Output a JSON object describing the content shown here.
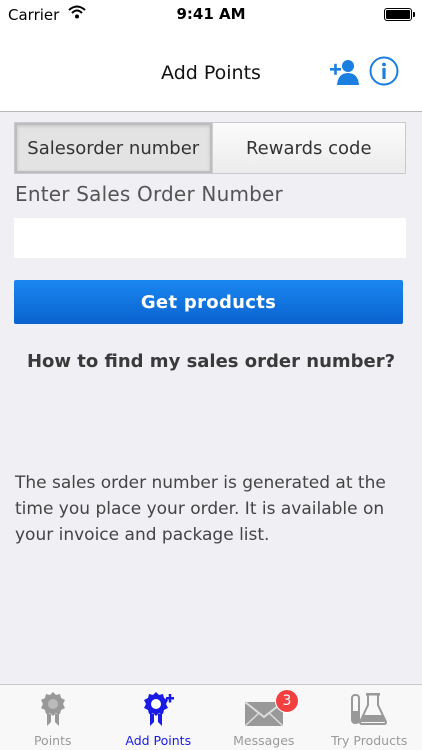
{
  "status_bar": {
    "carrier": "Carrier",
    "time": "9:41 AM"
  },
  "nav": {
    "title": "Add Points"
  },
  "segmented": {
    "options": [
      "Salesorder number",
      "Rewards code"
    ],
    "selected": "Salesorder number"
  },
  "form": {
    "field_label": "Enter Sales Order Number",
    "input_value": "",
    "input_placeholder": "",
    "submit_label": "Get products"
  },
  "help": {
    "heading": "How to find my sales order number?",
    "body": "The sales order number is generated at the time you place your order. It is available on your invoice and package list."
  },
  "tab_bar": {
    "items": [
      {
        "label": "Points",
        "icon": "award-badge-icon"
      },
      {
        "label": "Add Points",
        "icon": "add-badge-icon"
      },
      {
        "label": "Messages",
        "icon": "envelope-icon",
        "badge": "3"
      },
      {
        "label": "Try Products",
        "icon": "lab-flask-icon"
      }
    ],
    "selected": "Add Points"
  },
  "colors": {
    "accent": "#1a1ae6",
    "button": "#0a6fe0",
    "badge": "#f23f3f",
    "nav_icons": "#1a7fe0"
  }
}
